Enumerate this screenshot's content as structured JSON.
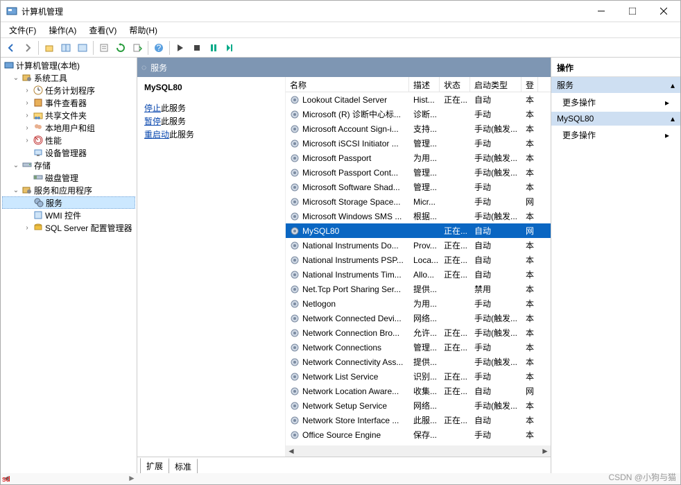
{
  "window": {
    "title": "计算机管理"
  },
  "menu": {
    "file": "文件(F)",
    "action": "操作(A)",
    "view": "查看(V)",
    "help": "帮助(H)"
  },
  "tree": {
    "root": "计算机管理(本地)",
    "system_tools": "系统工具",
    "task_scheduler": "任务计划程序",
    "event_viewer": "事件查看器",
    "shared_folders": "共享文件夹",
    "local_users": "本地用户和组",
    "performance": "性能",
    "device_manager": "设备管理器",
    "storage": "存储",
    "disk_mgmt": "磁盘管理",
    "services_apps": "服务和应用程序",
    "services": "服务",
    "wmi": "WMI 控件",
    "sql": "SQL Server 配置管理器"
  },
  "center": {
    "header": "服务",
    "selected_name": "MySQL80",
    "stop": "停止",
    "stop_suffix": "此服务",
    "pause": "暂停",
    "pause_suffix": "此服务",
    "restart": "重启动",
    "restart_suffix": "此服务",
    "cols": {
      "name": "名称",
      "desc": "描述",
      "status": "状态",
      "startup": "启动类型",
      "logon": "登"
    },
    "rows": [
      {
        "n": "Lookout Citadel Server",
        "d": "Hist...",
        "s": "正在...",
        "t": "自动",
        "l": "本"
      },
      {
        "n": "Microsoft (R) 诊断中心标...",
        "d": "诊断...",
        "s": "",
        "t": "手动",
        "l": "本"
      },
      {
        "n": "Microsoft Account Sign-i...",
        "d": "支持...",
        "s": "",
        "t": "手动(触发...",
        "l": "本"
      },
      {
        "n": "Microsoft iSCSI Initiator ...",
        "d": "管理...",
        "s": "",
        "t": "手动",
        "l": "本"
      },
      {
        "n": "Microsoft Passport",
        "d": "为用...",
        "s": "",
        "t": "手动(触发...",
        "l": "本"
      },
      {
        "n": "Microsoft Passport Cont...",
        "d": "管理...",
        "s": "",
        "t": "手动(触发...",
        "l": "本"
      },
      {
        "n": "Microsoft Software Shad...",
        "d": "管理...",
        "s": "",
        "t": "手动",
        "l": "本"
      },
      {
        "n": "Microsoft Storage Space...",
        "d": "Micr...",
        "s": "",
        "t": "手动",
        "l": "网"
      },
      {
        "n": "Microsoft Windows SMS ...",
        "d": "根据...",
        "s": "",
        "t": "手动(触发...",
        "l": "本"
      },
      {
        "n": "MySQL80",
        "d": "",
        "s": "正在...",
        "t": "自动",
        "l": "网",
        "sel": true
      },
      {
        "n": "National Instruments Do...",
        "d": "Prov...",
        "s": "正在...",
        "t": "自动",
        "l": "本"
      },
      {
        "n": "National Instruments PSP...",
        "d": "Loca...",
        "s": "正在...",
        "t": "自动",
        "l": "本"
      },
      {
        "n": "National Instruments Tim...",
        "d": "Allo...",
        "s": "正在...",
        "t": "自动",
        "l": "本"
      },
      {
        "n": "Net.Tcp Port Sharing Ser...",
        "d": "提供...",
        "s": "",
        "t": "禁用",
        "l": "本"
      },
      {
        "n": "Netlogon",
        "d": "为用...",
        "s": "",
        "t": "手动",
        "l": "本"
      },
      {
        "n": "Network Connected Devi...",
        "d": "网络...",
        "s": "",
        "t": "手动(触发...",
        "l": "本"
      },
      {
        "n": "Network Connection Bro...",
        "d": "允许...",
        "s": "正在...",
        "t": "手动(触发...",
        "l": "本"
      },
      {
        "n": "Network Connections",
        "d": "管理...",
        "s": "正在...",
        "t": "手动",
        "l": "本"
      },
      {
        "n": "Network Connectivity Ass...",
        "d": "提供...",
        "s": "",
        "t": "手动(触发...",
        "l": "本"
      },
      {
        "n": "Network List Service",
        "d": "识别...",
        "s": "正在...",
        "t": "手动",
        "l": "本"
      },
      {
        "n": "Network Location Aware...",
        "d": "收集...",
        "s": "正在...",
        "t": "自动",
        "l": "网"
      },
      {
        "n": "Network Setup Service",
        "d": "网络...",
        "s": "",
        "t": "手动(触发...",
        "l": "本"
      },
      {
        "n": "Network Store Interface ...",
        "d": "此服...",
        "s": "正在...",
        "t": "自动",
        "l": "本"
      },
      {
        "n": "Office  Source Engine",
        "d": "保存...",
        "s": "",
        "t": "手动",
        "l": "本"
      }
    ],
    "tab_ext": "扩展",
    "tab_std": "标准"
  },
  "actions": {
    "header": "操作",
    "section1": "服务",
    "more1": "更多操作",
    "section2": "MySQL80",
    "more2": "更多操作"
  },
  "footer": {
    "sd": "sd",
    "watermark": "CSDN @小狗与猫"
  }
}
